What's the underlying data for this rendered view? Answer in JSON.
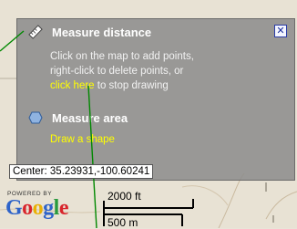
{
  "panel": {
    "measure_distance": "Measure distance",
    "desc_line1": "Click on the map to add points,",
    "desc_line2": "right-click to delete points, or",
    "stop_link": "click here",
    "stop_suffix": " to stop drawing",
    "measure_area": "Measure area",
    "draw_link": "Draw a shape",
    "close_symbol": "✕"
  },
  "map": {
    "center_label": "Center: 35.23931,-100.60241",
    "powered_by": "POWERED BY",
    "google_letters": [
      "G",
      "o",
      "o",
      "g",
      "l",
      "e"
    ],
    "scale_imperial": "2000 ft",
    "scale_metric": "500 m"
  },
  "colors": {
    "link": "#ffff00",
    "panel_bg": "#8c8c8c",
    "measure_line": "#008800"
  },
  "icons": {
    "ruler": "ruler-icon",
    "area": "polygon-icon",
    "close": "close-icon"
  }
}
